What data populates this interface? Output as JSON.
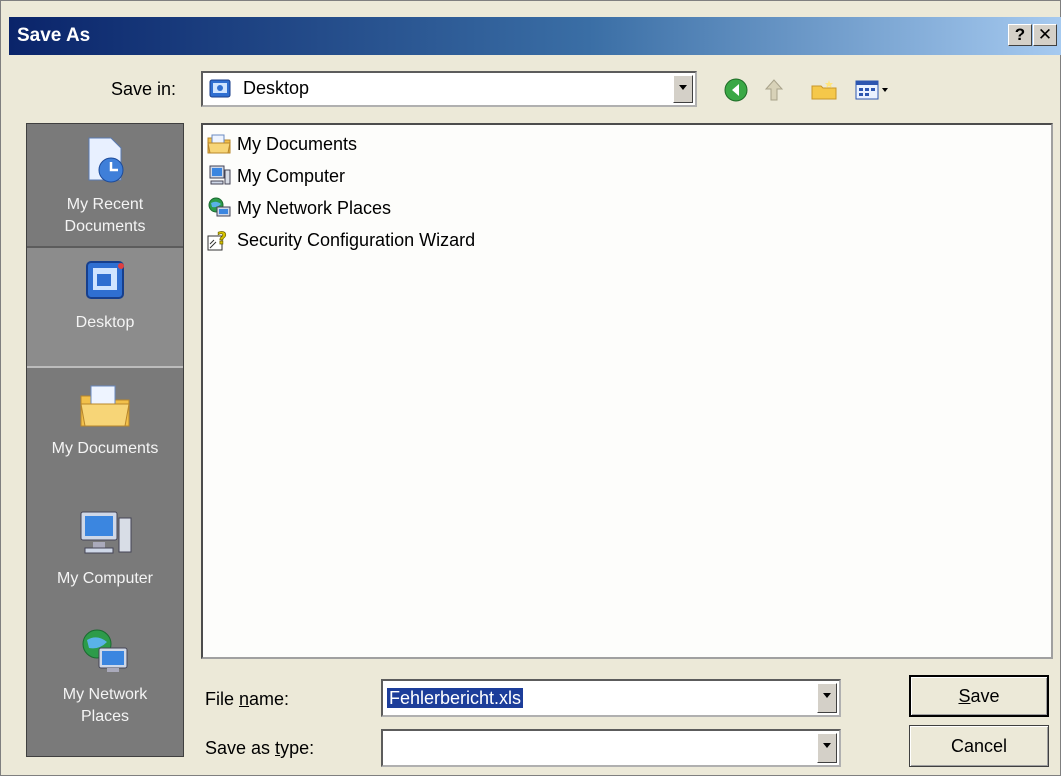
{
  "dialog": {
    "title": "Save As",
    "help_label": "?",
    "close_label": "✕"
  },
  "save_in": {
    "label": "Save in:",
    "value": "Desktop"
  },
  "toolbar": {
    "icons": [
      "back-icon",
      "up-folder-icon",
      "new-folder-icon",
      "view-menu-icon"
    ]
  },
  "places": [
    {
      "label": "My Recent Documents",
      "icon": "recent-documents-icon"
    },
    {
      "label": "Desktop",
      "icon": "desktop-icon"
    },
    {
      "label": "My Documents",
      "icon": "my-documents-icon"
    },
    {
      "label": "My Computer",
      "icon": "my-computer-icon"
    },
    {
      "label": "My Network Places",
      "icon": "my-network-places-icon"
    }
  ],
  "files": [
    {
      "label": "My Documents",
      "icon": "folder-documents-icon"
    },
    {
      "label": "My Computer",
      "icon": "computer-icon"
    },
    {
      "label": "My Network Places",
      "icon": "network-places-icon"
    },
    {
      "label": "Security Configuration Wizard",
      "icon": "wizard-shortcut-icon"
    }
  ],
  "file_name": {
    "label": "File name:",
    "value": "Fehlerbericht.xls"
  },
  "save_as_type": {
    "label": "Save as type:",
    "value": ""
  },
  "buttons": {
    "save_label": "Save",
    "cancel_label": "Cancel"
  },
  "colors": {
    "title_gradient_start": "#0a246a",
    "places_bar": "#7a7a7a",
    "selection": "#1c3d9a"
  }
}
